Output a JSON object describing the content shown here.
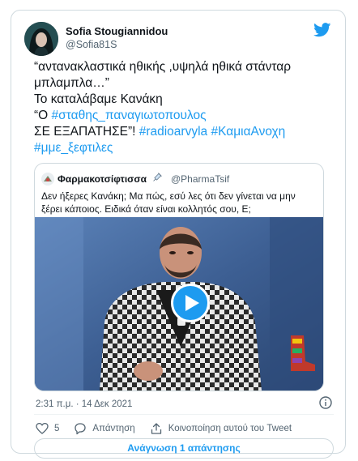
{
  "colors": {
    "accent": "#1d9bf0",
    "text": "#0f1419",
    "muted": "#536471",
    "border": "#cfd9de"
  },
  "author": {
    "display_name": "Sofia Stougiannidou",
    "handle": "@Sofia81S"
  },
  "tweet": {
    "line1": "“αντανακλαστικά ηθικής ,υψηλά ηθικά στάνταρ",
    "line2": "μπλαμπλα…”",
    "line3": "Το καταλάβαμε  Κανάκη",
    "line4_prefix": "“Ο ",
    "hashtag1": "#σταθης_παναγιωτοπουλος",
    "line5_prefix": "ΣΕ ΕΞΑΠΑΤΗΣΕ”! ",
    "hashtag2": "#radioarvyla",
    "hashtag3": "#ΚαμιαΑνοχη",
    "hashtag4": "#μμε_ξεφτιλες"
  },
  "quoted": {
    "display_name": "Φαρμακοτσίφτισσα",
    "handle": "@PharmaTsif",
    "text": "Δεν ήξερες Κανάκη; Μα πώς, εσύ λες ότι δεν γίνεται να μην ξέρει κάποιος. Ειδικά όταν είναι κολλητός σου, Ε;"
  },
  "timestamp": "2:31 π.μ. · 14 Δεκ 2021",
  "actions": {
    "like_count": "5",
    "reply_label": "Απάντηση",
    "share_label": "Κοινοποίηση αυτού του Tweet"
  },
  "read_replies_label": "Ανάγνωση 1 απάντησης",
  "icons": [
    "twitter-bird-icon",
    "syringe-icon",
    "play-icon",
    "info-icon",
    "heart-icon",
    "reply-icon",
    "share-icon"
  ]
}
